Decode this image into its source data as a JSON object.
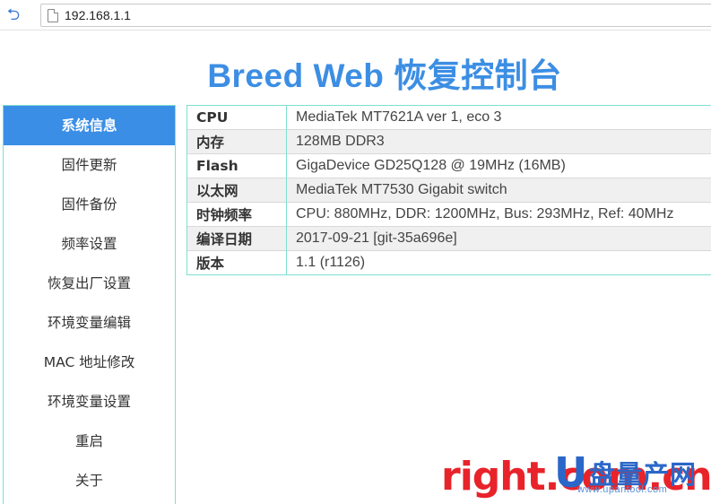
{
  "browser": {
    "url": "192.168.1.1"
  },
  "page": {
    "title": "Breed Web 恢复控制台"
  },
  "sidebar": {
    "items": [
      {
        "label": "系统信息",
        "active": true
      },
      {
        "label": "固件更新"
      },
      {
        "label": "固件备份"
      },
      {
        "label": "频率设置"
      },
      {
        "label": "恢复出厂设置"
      },
      {
        "label": "环境变量编辑"
      },
      {
        "label": "MAC 地址修改"
      },
      {
        "label": "环境变量设置"
      },
      {
        "label": "重启"
      },
      {
        "label": "关于"
      }
    ]
  },
  "system_info": {
    "rows": [
      {
        "key": "CPU",
        "value": "MediaTek MT7621A ver 1, eco 3"
      },
      {
        "key": "内存",
        "value": "128MB DDR3"
      },
      {
        "key": "Flash",
        "value": "GigaDevice GD25Q128 @ 19MHz (16MB)"
      },
      {
        "key": "以太网",
        "value": "MediaTek MT7530 Gigabit switch"
      },
      {
        "key": "时钟频率",
        "value": "CPU: 880MHz, DDR: 1200MHz, Bus: 293MHz, Ref: 40MHz"
      },
      {
        "key": "编译日期",
        "value": "2017-09-21 [git-35a696e]"
      },
      {
        "key": "版本",
        "value": "1.1 (r1126)"
      }
    ]
  },
  "watermark": {
    "part1": "right.com.cn",
    "logo_letter": "U",
    "logo_text": "盘量产网",
    "url": "www.upantool.com"
  },
  "colors": {
    "accent": "#3a8ee6",
    "title": "#3c8ee4",
    "border": "#7fe0cf",
    "watermark_red": "#e8232a",
    "watermark_blue": "#2a67c8"
  },
  "icons": {
    "back": "back-arrow-icon",
    "page": "page-icon"
  }
}
